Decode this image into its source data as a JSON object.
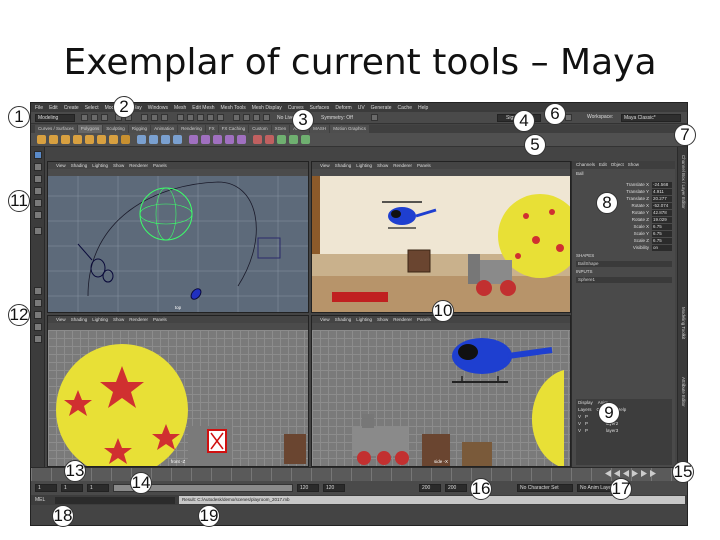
{
  "title": "Exemplar of current tools – Maya",
  "menu": [
    "File",
    "Edit",
    "Create",
    "Select",
    "Modify",
    "Display",
    "Windows",
    "Mesh",
    "Edit Mesh",
    "Mesh Tools",
    "Mesh Display",
    "Curves",
    "Surfaces",
    "Deform",
    "UV",
    "Generate",
    "Cache",
    "Help"
  ],
  "status_line": {
    "mode": "Modeling",
    "no_live_surface": "No Live Surface",
    "symmetry": "Symmetry: Off",
    "sign_in": "Sign in",
    "workspace_label": "Workspace:",
    "workspace_value": "Maya Classic*"
  },
  "shelf_tabs": [
    "Curves / Surfaces",
    "Polygons",
    "Sculpting",
    "Rigging",
    "Animation",
    "Rendering",
    "FX",
    "FX Caching",
    "Custom",
    "XGen",
    "Arnold",
    "MASH",
    "Motion Graphics"
  ],
  "panel_menu": [
    "View",
    "Shading",
    "Lighting",
    "Show",
    "Renderer",
    "Panels"
  ],
  "viewports": {
    "top_left_label": "top",
    "bottom_left_label": "front -Z",
    "bottom_right_label": "side -X"
  },
  "channel_box": {
    "tabs": [
      "Channels",
      "Edit",
      "Object",
      "Show"
    ],
    "object": "Ball",
    "rows": [
      {
        "k": "Translate X",
        "v": "-24.568"
      },
      {
        "k": "Translate Y",
        "v": "4.911"
      },
      {
        "k": "Translate Z",
        "v": "20.277"
      },
      {
        "k": "Rotate X",
        "v": "-52.074"
      },
      {
        "k": "Rotate Y",
        "v": "42.878"
      },
      {
        "k": "Rotate Z",
        "v": "19.029"
      },
      {
        "k": "Scale X",
        "v": "6.75"
      },
      {
        "k": "Scale Y",
        "v": "6.75"
      },
      {
        "k": "Scale Z",
        "v": "6.75"
      },
      {
        "k": "Visibility",
        "v": "on"
      }
    ],
    "shapes_label": "SHAPES",
    "shape_name": "BallShape",
    "inputs_label": "INPUTS",
    "input_name": "Sphere1"
  },
  "layer_editor": {
    "tabs": [
      "Display",
      "Anim"
    ],
    "menu": [
      "Layers",
      "Options",
      "Help"
    ],
    "layers": [
      "layer4",
      "layer2",
      "layer3"
    ],
    "v_label": "V",
    "p_label": "P"
  },
  "side_tabs": [
    "Channel Box / Layer Editor",
    "Modeling Toolkit",
    "Attribute Editor"
  ],
  "range": {
    "start": "1",
    "playback_start": "1",
    "current": "1",
    "playback_end": "120",
    "anim_end": "120",
    "end": "200",
    "end2": "200",
    "character_set": "No Character Set",
    "anim_layer": "No Anim Layer"
  },
  "command_line": {
    "mel": "MEL",
    "result": "Result: C:/Autodesk/demo/scenes/playroom_2017.mb"
  },
  "callouts": [
    "1",
    "2",
    "3",
    "4",
    "5",
    "6",
    "7",
    "8",
    "9",
    "10",
    "11",
    "12",
    "13",
    "14",
    "15",
    "16",
    "17",
    "18",
    "19"
  ]
}
